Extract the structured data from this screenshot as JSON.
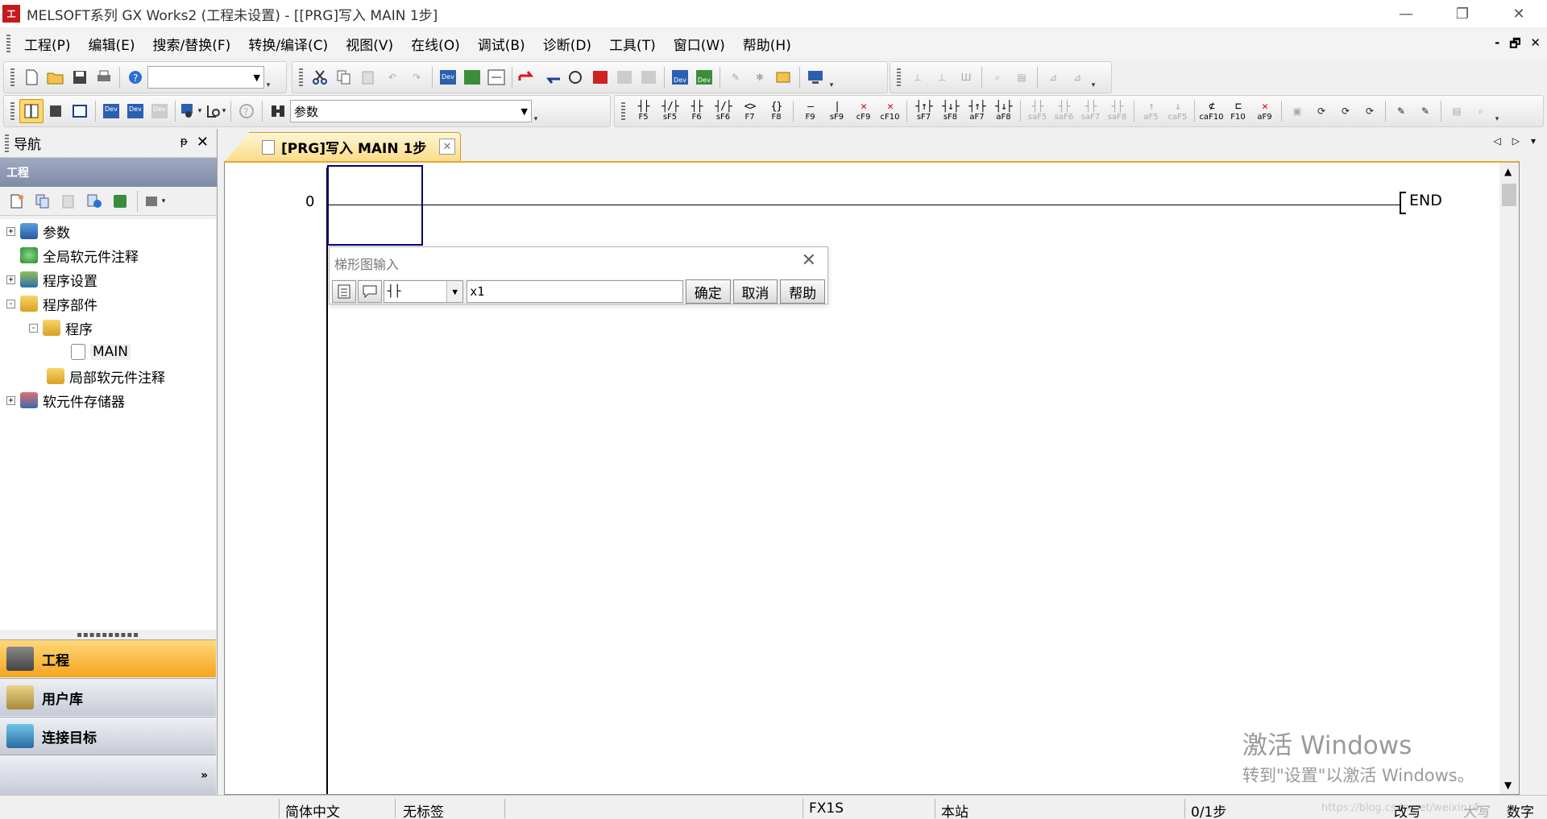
{
  "window": {
    "app_icon_text": "工",
    "title": "MELSOFT系列 GX Works2 (工程未设置) - [[PRG]写入 MAIN 1步]",
    "minimize": "—",
    "restore": "❐",
    "close": "✕"
  },
  "menu": {
    "items": [
      "工程(P)",
      "编辑(E)",
      "搜索/替换(F)",
      "转换/编译(C)",
      "视图(V)",
      "在线(O)",
      "调试(B)",
      "诊断(D)",
      "工具(T)",
      "窗口(W)",
      "帮助(H)"
    ],
    "mdi_min": "-",
    "mdi_restore": "🗗",
    "mdi_close": "✕"
  },
  "toolbar1": {
    "combo_value": "",
    "dev_label": "Dev"
  },
  "toolbar2": {
    "combo_value": "参数",
    "dev_label": "Dev"
  },
  "fkeys": [
    {
      "sym": "┤├",
      "label": "F5"
    },
    {
      "sym": "┤/├",
      "label": "sF5"
    },
    {
      "sym": "┤├",
      "label": "F6"
    },
    {
      "sym": "┤/├",
      "label": "sF6"
    },
    {
      "sym": "<>",
      "label": "F7"
    },
    {
      "sym": "{}",
      "label": "F8"
    },
    {
      "sym": "—",
      "label": "F9"
    },
    {
      "sym": "|",
      "label": "sF9"
    },
    {
      "sym": "✕",
      "label": "cF9"
    },
    {
      "sym": "✕",
      "label": "cF10"
    },
    {
      "sym": "┤↑├",
      "label": "sF7"
    },
    {
      "sym": "┤↓├",
      "label": "sF8"
    },
    {
      "sym": "┤↑├",
      "label": "aF7"
    },
    {
      "sym": "┤↓├",
      "label": "aF8"
    },
    {
      "sym": "┤├",
      "label": "saF5"
    },
    {
      "sym": "┤├",
      "label": "saF6"
    },
    {
      "sym": "┤├",
      "label": "saF7"
    },
    {
      "sym": "┤├",
      "label": "saF8"
    },
    {
      "sym": "↑",
      "label": "aF5"
    },
    {
      "sym": "↓",
      "label": "caF5"
    },
    {
      "sym": "⊄",
      "label": "caF10"
    },
    {
      "sym": "⊏",
      "label": "F10"
    },
    {
      "sym": "✕",
      "label": "aF9"
    }
  ],
  "nav": {
    "header": "导航",
    "pin": "ᵽ",
    "close": "✕",
    "section": "工程",
    "tree": [
      {
        "label": "参数",
        "expander": "+"
      },
      {
        "label": "全局软元件注释",
        "expander": ""
      },
      {
        "label": "程序设置",
        "expander": "+"
      },
      {
        "label": "程序部件",
        "expander": "-"
      },
      {
        "label": "程序",
        "expander": "-"
      },
      {
        "label": "MAIN",
        "expander": ""
      },
      {
        "label": "局部软元件注释",
        "expander": ""
      },
      {
        "label": "软元件存储器",
        "expander": "+"
      }
    ],
    "splitter": "▪▪▪▪▪▪▪▪▪▪",
    "buttons": [
      "工程",
      "用户库",
      "连接目标"
    ],
    "footer": "»"
  },
  "doc_tab": {
    "label": "[PRG]写入 MAIN 1步",
    "close": "✕",
    "nav_left": "◁",
    "nav_right": "▷",
    "nav_menu": "▾"
  },
  "ladder": {
    "step": "0",
    "end_label": "END"
  },
  "ladder_dialog": {
    "title": "梯形图输入",
    "close": "✕",
    "combo_value": "┤├",
    "input_value": "x1",
    "ok": "确定",
    "cancel": "取消",
    "help": "帮助"
  },
  "watermark": {
    "line1": "激活 Windows",
    "line2": "转到\"设置\"以激活 Windows。"
  },
  "status": {
    "language": "简体中文",
    "label": "无标签",
    "plc": "FX1S",
    "station": "本站",
    "steps": "0/1步",
    "overwrite": "改写",
    "caps": "大写",
    "num": "数字",
    "blog": "https://blog.csdn.net/weixin_4..."
  },
  "colors": {
    "accent_orange": "#f4a51d",
    "cursor_blue": "#000080",
    "nav_section": "#8a94ae"
  }
}
